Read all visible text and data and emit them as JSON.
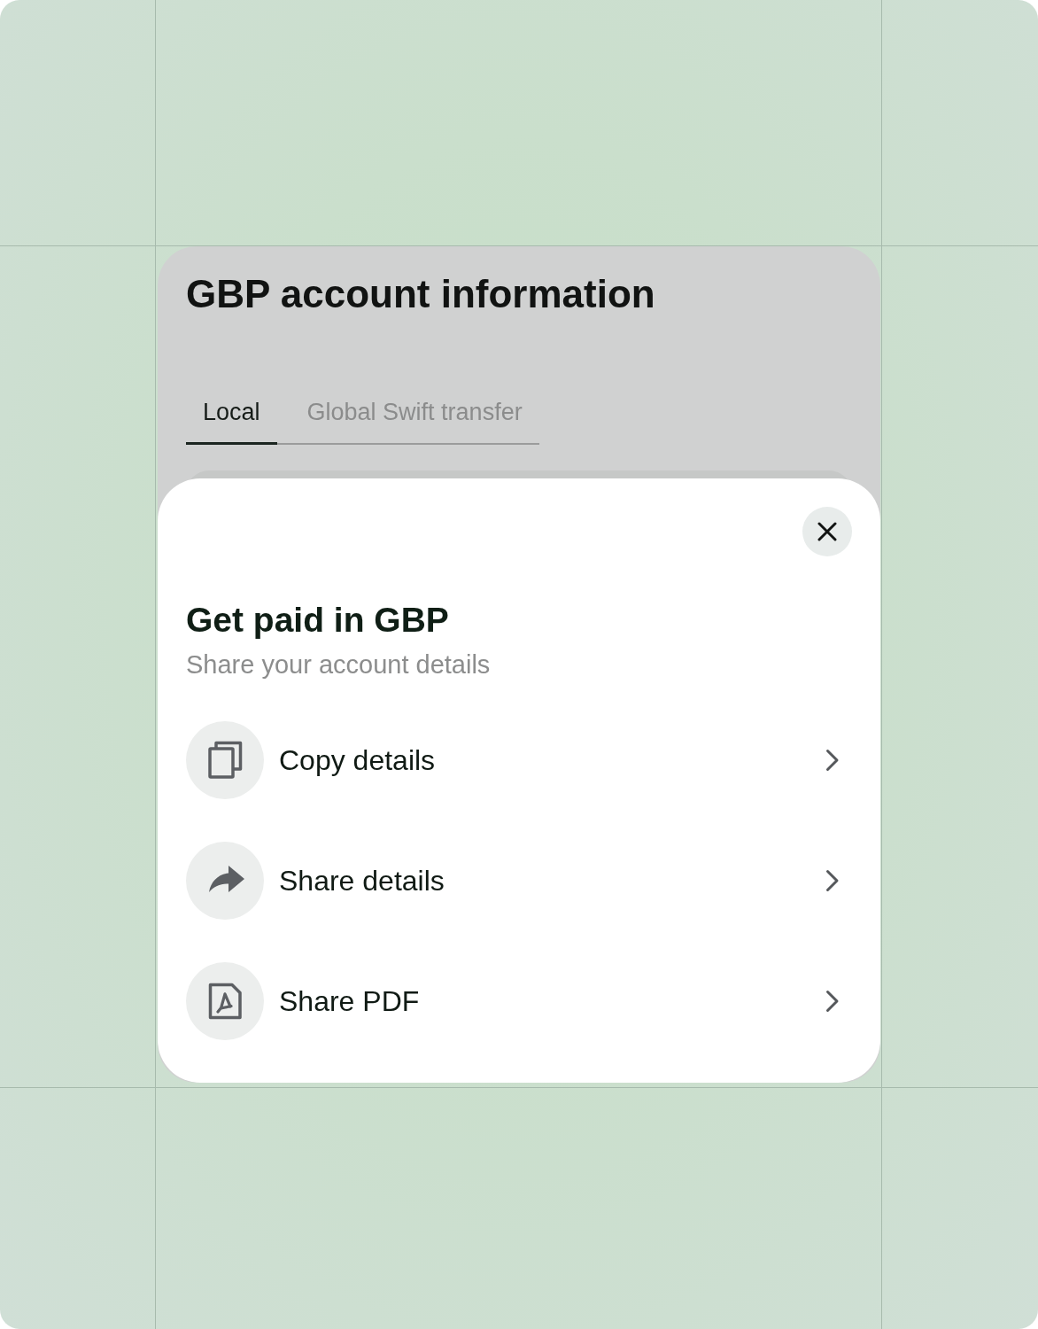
{
  "page": {
    "title": "GBP account information",
    "tabs": [
      {
        "label": "Local",
        "selected": true
      },
      {
        "label": "Global Swift transfer",
        "selected": false
      }
    ]
  },
  "sheet": {
    "title": "Get paid in GBP",
    "subtitle": "Share your account details",
    "actions": [
      {
        "kind": "copy",
        "label": "Copy details"
      },
      {
        "kind": "share",
        "label": "Share details"
      },
      {
        "kind": "pdf",
        "label": "Share PDF"
      }
    ]
  }
}
